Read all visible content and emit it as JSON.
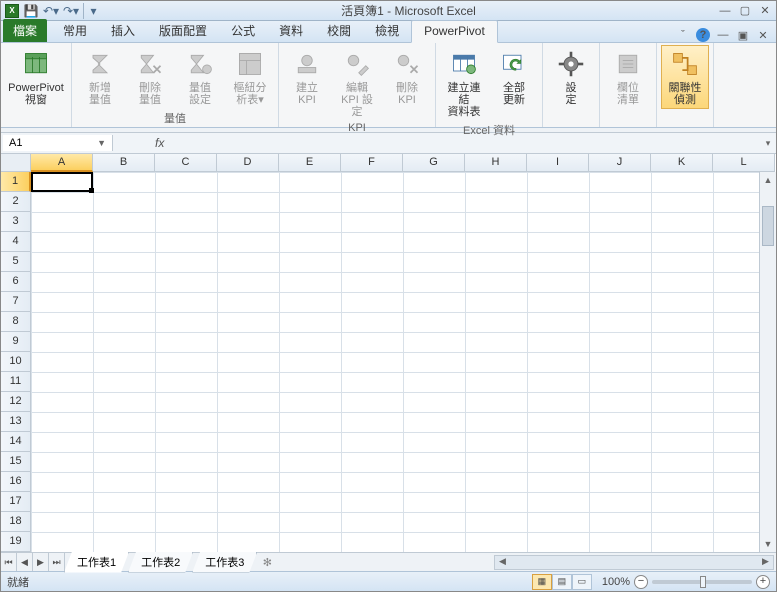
{
  "titlebar": {
    "title": "活頁簿1 - Microsoft Excel"
  },
  "tabs": {
    "file": "檔案",
    "items": [
      "常用",
      "插入",
      "版面配置",
      "公式",
      "資料",
      "校閱",
      "檢視",
      "PowerPivot"
    ],
    "active": "PowerPivot"
  },
  "ribbon": {
    "groups": [
      {
        "label": "",
        "buttons": [
          {
            "key": "pp_window",
            "label": "PowerPivot\n視窗",
            "icon": "cube-green",
            "enabled": true
          }
        ]
      },
      {
        "label": "量值",
        "buttons": [
          {
            "key": "new_measure",
            "label": "新增\n量值",
            "icon": "sigma",
            "enabled": false
          },
          {
            "key": "del_measure",
            "label": "刪除\n量值",
            "icon": "sigma-x",
            "enabled": false
          },
          {
            "key": "measure_settings",
            "label": "量值\n設定",
            "icon": "sigma-gear",
            "enabled": false
          },
          {
            "key": "pivot_analyze",
            "label": "樞紐分\n析表▾",
            "icon": "pivot",
            "enabled": false
          }
        ]
      },
      {
        "label": "KPI",
        "buttons": [
          {
            "key": "kpi_new",
            "label": "建立\nKPI",
            "icon": "kpi",
            "enabled": false
          },
          {
            "key": "kpi_edit",
            "label": "編輯\nKPI 設定",
            "icon": "kpi-edit",
            "enabled": false
          },
          {
            "key": "kpi_del",
            "label": "刪除\nKPI",
            "icon": "kpi-del",
            "enabled": false
          }
        ]
      },
      {
        "label": "Excel 資料",
        "buttons": [
          {
            "key": "linked_table",
            "label": "建立連結\n資料表",
            "icon": "table-link",
            "enabled": true
          },
          {
            "key": "update_all",
            "label": "全部\n更新",
            "icon": "refresh",
            "enabled": true
          }
        ]
      },
      {
        "label": "",
        "buttons": [
          {
            "key": "settings",
            "label": "設\n定",
            "icon": "gear",
            "enabled": true
          }
        ]
      },
      {
        "label": "",
        "buttons": [
          {
            "key": "field_list",
            "label": "欄位\n清單",
            "icon": "list",
            "enabled": false
          }
        ]
      },
      {
        "label": "",
        "buttons": [
          {
            "key": "relation_detect",
            "label": "關聯性\n偵測",
            "icon": "relation",
            "enabled": true,
            "highlighted": true
          }
        ]
      }
    ]
  },
  "nameBox": {
    "value": "A1"
  },
  "formulaBar": {
    "fx": "fx",
    "value": ""
  },
  "columns": [
    "A",
    "B",
    "C",
    "D",
    "E",
    "F",
    "G",
    "H",
    "I",
    "J",
    "K",
    "L"
  ],
  "rows": [
    1,
    2,
    3,
    4,
    5,
    6,
    7,
    8,
    9,
    10,
    11,
    12,
    13,
    14,
    15,
    16,
    17,
    18,
    19
  ],
  "activeCell": {
    "col": "A",
    "row": 1
  },
  "sheets": {
    "items": [
      "工作表1",
      "工作表2",
      "工作表3"
    ],
    "active": "工作表1"
  },
  "statusbar": {
    "status": "就緒",
    "zoom": "100%"
  }
}
